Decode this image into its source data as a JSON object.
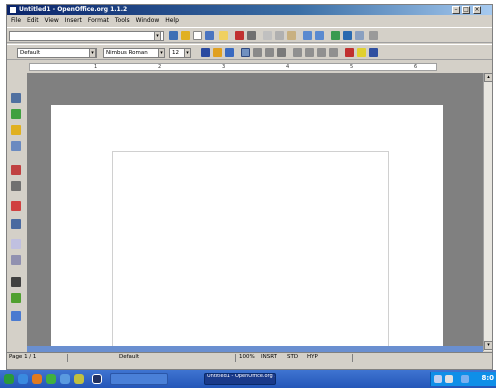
{
  "window": {
    "title": "Untitled1 - OpenOffice.org 1.1.2"
  },
  "menu": {
    "items": [
      "File",
      "Edit",
      "View",
      "Insert",
      "Format",
      "Tools",
      "Window",
      "Help"
    ]
  },
  "format_toolbar": {
    "paragraph_style": "Default",
    "font_name": "Nimbus Roman",
    "font_size": "12"
  },
  "ruler": {
    "labels": [
      "1",
      "2",
      "3",
      "4",
      "5",
      "6"
    ]
  },
  "statusbar": {
    "page": "Page 1 / 1",
    "page_style": "Default",
    "zoom": "100%",
    "insert_mode": "INSRT",
    "selection_mode": "STD",
    "hyperlink_mode": "HYP"
  },
  "taskbar": {
    "tasks": [
      {
        "label": "Untitled1 - OpenOffice.org 1.1"
      }
    ],
    "clock": "8:0"
  },
  "colors": {
    "titlebar": "#0a246a",
    "taskbar": "#2456b8",
    "selection": "#6a8fd0"
  }
}
